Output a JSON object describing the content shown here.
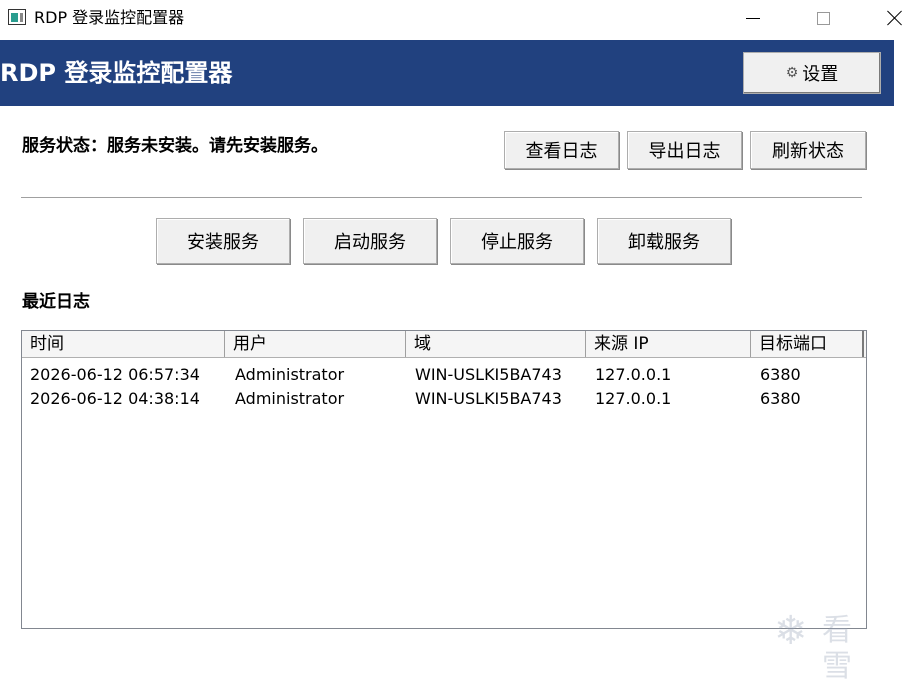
{
  "window": {
    "title": "RDP 登录监控配置器"
  },
  "header": {
    "title": "RDP 登录监控配置器",
    "settings_label": "设置",
    "settings_icon": "gear-icon",
    "bg_color": "#21417f"
  },
  "status": {
    "text": "服务状态：服务未安装。请先安装服务。"
  },
  "toolbar": {
    "view_log": "查看日志",
    "export_log": "导出日志",
    "refresh_status": "刷新状态"
  },
  "service_actions": {
    "install": "安装服务",
    "start": "启动服务",
    "stop": "停止服务",
    "uninstall": "卸载服务"
  },
  "logs": {
    "title": "最近日志",
    "columns": [
      "时间",
      "用户",
      "域",
      "来源 IP",
      "目标端口"
    ],
    "rows": [
      [
        "2026-06-12 06:57:34",
        "Administrator",
        "WIN-USLKI5BA743",
        "127.0.0.1",
        "6380"
      ],
      [
        "2026-06-12 04:38:14",
        "Administrator",
        "WIN-USLKI5BA743",
        "127.0.0.1",
        "6380"
      ]
    ]
  },
  "watermark": {
    "text": "看雪"
  }
}
